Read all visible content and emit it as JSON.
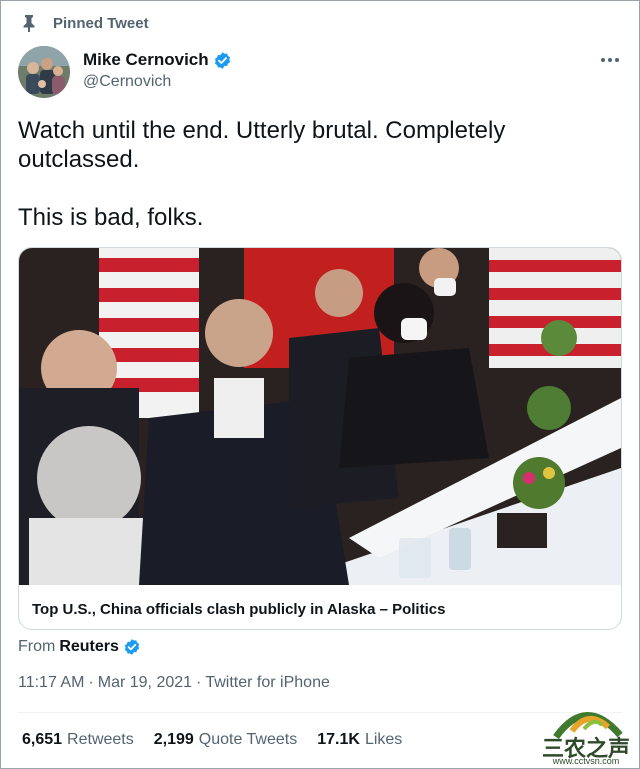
{
  "pinned": {
    "label": "Pinned Tweet"
  },
  "author": {
    "display_name": "Mike Cernovich",
    "handle": "@Cernovich"
  },
  "tweet": {
    "text": "Watch until the end. Utterly brutal. Completely\noutclassed.\n\nThis is bad, folks."
  },
  "card": {
    "title": "Top U.S., China officials clash publicly in Alaska – Politics"
  },
  "source": {
    "prefix": "From",
    "name": "Reuters"
  },
  "meta": {
    "time": "11:17 AM",
    "date": "Mar 19, 2021",
    "client": "Twitter for iPhone",
    "separator": "·"
  },
  "stats": {
    "retweets": {
      "count": "6,651",
      "label": "Retweets"
    },
    "quote_tweets": {
      "count": "2,199",
      "label": "Quote Tweets"
    },
    "likes": {
      "count": "17.1K",
      "label": "Likes"
    }
  },
  "watermark": {
    "text": "三农之声",
    "url": "www.cctvsn.com"
  },
  "colors": {
    "verified": "#1d9bf0",
    "secondary_text": "#536471",
    "primary_text": "#0f1419",
    "border": "#cfd9de"
  },
  "icons": {
    "pin": "pin-icon",
    "verified": "verified-badge-icon",
    "more": "more-options-icon"
  }
}
